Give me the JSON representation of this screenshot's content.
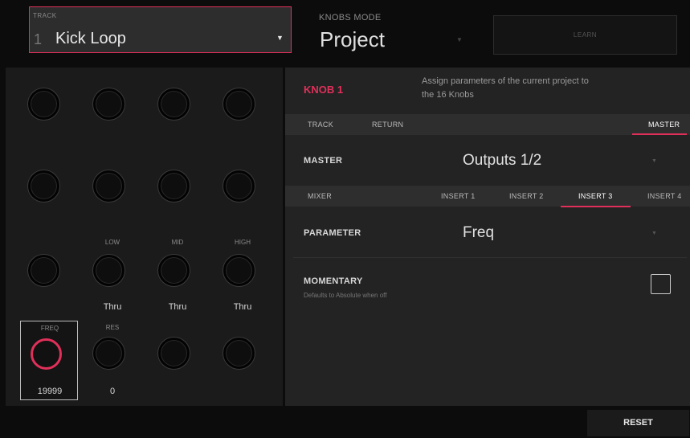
{
  "track": {
    "caption": "TRACK",
    "number": "1",
    "name": "Kick Loop"
  },
  "knobs_mode": {
    "caption": "KNOBS MODE",
    "value": "Project"
  },
  "learn_label": "LEARN",
  "knob_info": {
    "title": "KNOB 1",
    "description": "Assign parameters of the current project to the 16 Knobs"
  },
  "target_tabs": [
    {
      "label": "TRACK",
      "active": false
    },
    {
      "label": "RETURN",
      "active": false
    },
    {
      "label": "MASTER",
      "active": true
    }
  ],
  "master_row": {
    "label": "MASTER",
    "value": "Outputs 1/2"
  },
  "insert_tabs": [
    {
      "label": "MIXER",
      "active": false
    },
    {
      "label": "INSERT 1",
      "active": false
    },
    {
      "label": "INSERT 2",
      "active": false
    },
    {
      "label": "INSERT 3",
      "active": true
    },
    {
      "label": "INSERT 4",
      "active": false
    }
  ],
  "parameter_row": {
    "label": "PARAMETER",
    "value": "Freq"
  },
  "momentary": {
    "label": "MOMENTARY",
    "sublabel": "Defaults to Absolute when off",
    "checked": false
  },
  "knob_labels": {
    "low": "LOW",
    "mid": "MID",
    "high": "HIGH",
    "freq": "FREQ",
    "res": "RES"
  },
  "knob_values": {
    "low": "Thru",
    "mid": "Thru",
    "high": "Thru",
    "freq": "19999",
    "res": "0"
  },
  "reset_label": "RESET",
  "colors": {
    "accent": "#e0305a",
    "panel_left": "#1b1b1b",
    "panel_right": "#232323"
  }
}
